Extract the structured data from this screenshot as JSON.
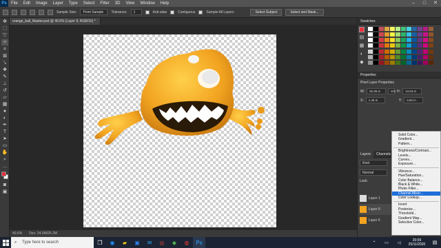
{
  "menu": [
    "File",
    "Edit",
    "Image",
    "Layer",
    "Type",
    "Select",
    "Filter",
    "3D",
    "View",
    "Window",
    "Help"
  ],
  "app_logo": "Ps",
  "window_controls": [
    "–",
    "□",
    "✕"
  ],
  "options_bar": {
    "sample_size_label": "Sample Size:",
    "sample_size_value": "Point Sample",
    "tolerance_label": "Tolerance:",
    "tolerance_value": "1",
    "anti_alias": "Anti-alias",
    "contiguous": "Contiguous",
    "sample_all_layers": "Sample All Layers",
    "select_subject": "Select Subject",
    "select_and_mask": "Select and Mask..."
  },
  "document_tab": "orange_ball_Master.psd @ 40.6% (Layer 9, RGB/16) *",
  "status": {
    "zoom": "40.6%",
    "doc_size": "Doc: 24.0M/25.2M"
  },
  "swatches_panel": {
    "title": "Swatches"
  },
  "properties_panel": {
    "title": "Properties",
    "subtitle": "Pixel Layer Properties",
    "w_label": "W:",
    "w_value": "25.36 in",
    "go_label": "GO",
    "h_label": "H:",
    "h_value": "13.04 in",
    "x_label": "X:",
    "x_value": "1.46 in",
    "y_label": "Y:",
    "y_value": "3.82 in"
  },
  "layers_panel": {
    "tabs": [
      "Layers",
      "Channels"
    ],
    "kind": "Kind",
    "blend": "Normal",
    "lock": "Lock:",
    "layers": [
      "Layer 1",
      "Layer 9",
      "Layer 6"
    ]
  },
  "context_menu": {
    "groups": [
      [
        "Solid Color...",
        "Gradient...",
        "Pattern..."
      ],
      [
        "Brightness/Contrast...",
        "Levels...",
        "Curves...",
        "Exposure..."
      ],
      [
        "Vibrance...",
        "Hue/Saturation...",
        "Color Balance...",
        "Black & White...",
        "Photo Filter...",
        "Channel Mixer...",
        "Color Lookup..."
      ],
      [
        "Invert",
        "Posterize...",
        "Threshold...",
        "Gradient Map...",
        "Selective Color..."
      ]
    ],
    "highlighted": "Channel Mixer..."
  },
  "taskbar": {
    "search_placeholder": "Type here to search",
    "time": "20:09",
    "date": "25/11/2020"
  },
  "colors": {
    "accent": "#1e6fd9",
    "character_orange": "#f2a421",
    "foreground_swatch": "#e8313f",
    "background_swatch": "#ffffff"
  }
}
